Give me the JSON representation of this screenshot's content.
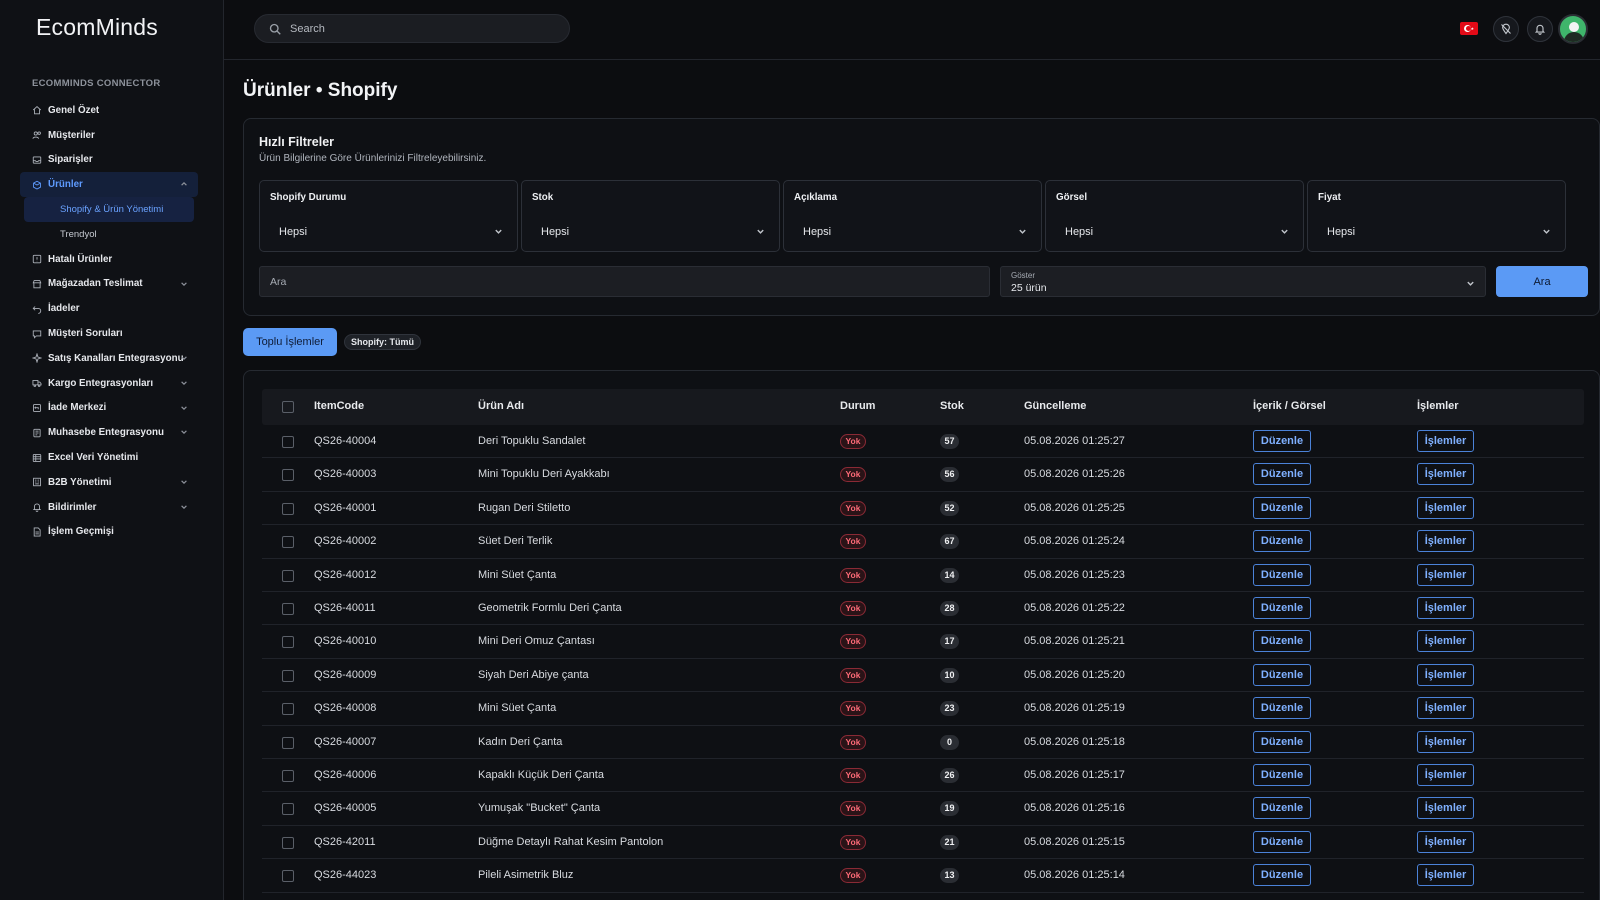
{
  "app": {
    "logo": "EcomMinds",
    "section_title": "ECOMMINDS CONNECTOR"
  },
  "sidebar": {
    "items": [
      {
        "label": "Genel Özet",
        "icon": "home-icon",
        "chevron": false
      },
      {
        "label": "Müşteriler",
        "icon": "users-icon",
        "chevron": false
      },
      {
        "label": "Siparişler",
        "icon": "inbox-icon",
        "chevron": false
      },
      {
        "label": "Ürünler",
        "icon": "box-icon",
        "chevron": true,
        "active": true
      },
      {
        "label": "Hatalı Ürünler",
        "icon": "alert-box-icon",
        "chevron": false
      },
      {
        "label": "Mağazadan Teslimat",
        "icon": "store-icon",
        "chevron": true
      },
      {
        "label": "İadeler",
        "icon": "return-icon",
        "chevron": false
      },
      {
        "label": "Müşteri Soruları",
        "icon": "chat-icon",
        "chevron": false
      },
      {
        "label": "Satış Kanalları Entegrasyonu",
        "icon": "sparkle-icon",
        "chevron": true
      },
      {
        "label": "Kargo Entegrasyonları",
        "icon": "truck-icon",
        "chevron": true
      },
      {
        "label": "İade Merkezi",
        "icon": "return-box-icon",
        "chevron": true
      },
      {
        "label": "Muhasebe Entegrasyonu",
        "icon": "ledger-icon",
        "chevron": true
      },
      {
        "label": "Excel Veri Yönetimi",
        "icon": "table-icon",
        "chevron": false
      },
      {
        "label": "B2B Yönetimi",
        "icon": "building-icon",
        "chevron": true
      },
      {
        "label": "Bildirimler",
        "icon": "bell-icon",
        "chevron": true
      },
      {
        "label": "İşlem Geçmişi",
        "icon": "document-icon",
        "chevron": false
      }
    ],
    "sub_items": [
      {
        "label": "Shopify & Ürün Yönetimi",
        "active": true
      },
      {
        "label": "Trendyol",
        "active": false
      }
    ]
  },
  "topbar": {
    "search_placeholder": "Search"
  },
  "page": {
    "title": "Ürünler • Shopify"
  },
  "filters": {
    "title": "Hızlı Filtreler",
    "subtitle": "Ürün Bilgilerine Göre Ürünlerinizi Filtreleyebilirsiniz.",
    "boxes": [
      {
        "label": "Shopify Durumu",
        "value": "Hepsi"
      },
      {
        "label": "Stok",
        "value": "Hepsi"
      },
      {
        "label": "Açıklama",
        "value": "Hepsi"
      },
      {
        "label": "Görsel",
        "value": "Hepsi"
      },
      {
        "label": "Fiyat",
        "value": "Hepsi"
      }
    ],
    "search_placeholder": "Ara",
    "show_label": "Göster",
    "show_value": "25 ürün",
    "search_button": "Ara"
  },
  "actions": {
    "bulk_button": "Toplu İşlemler",
    "chip": "Shopify: Tümü"
  },
  "table": {
    "headers": [
      "ItemCode",
      "Ürün Adı",
      "Durum",
      "Stok",
      "Güncelleme",
      "İçerik / Görsel",
      "İşlemler"
    ],
    "edit_label": "Düzenle",
    "actions_label": "İşlemler",
    "status_color": "#ff6b78",
    "rows": [
      {
        "code": "QS26-40004",
        "name": "Deri Topuklu Sandalet",
        "status": "Yok",
        "stock": "57",
        "updated": "05.08.2026 01:25:27"
      },
      {
        "code": "QS26-40003",
        "name": "Mini Topuklu Deri Ayakkabı",
        "status": "Yok",
        "stock": "56",
        "updated": "05.08.2026 01:25:26"
      },
      {
        "code": "QS26-40001",
        "name": "Rugan Deri Stiletto",
        "status": "Yok",
        "stock": "52",
        "updated": "05.08.2026 01:25:25"
      },
      {
        "code": "QS26-40002",
        "name": "Süet Deri Terlik",
        "status": "Yok",
        "stock": "67",
        "updated": "05.08.2026 01:25:24"
      },
      {
        "code": "QS26-40012",
        "name": "Mini Süet Çanta",
        "status": "Yok",
        "stock": "14",
        "updated": "05.08.2026 01:25:23"
      },
      {
        "code": "QS26-40011",
        "name": "Geometrik Formlu Deri Çanta",
        "status": "Yok",
        "stock": "28",
        "updated": "05.08.2026 01:25:22"
      },
      {
        "code": "QS26-40010",
        "name": "Mini Deri Omuz Çantası",
        "status": "Yok",
        "stock": "17",
        "updated": "05.08.2026 01:25:21"
      },
      {
        "code": "QS26-40009",
        "name": "Siyah Deri Abiye çanta",
        "status": "Yok",
        "stock": "10",
        "updated": "05.08.2026 01:25:20"
      },
      {
        "code": "QS26-40008",
        "name": "Mini Süet Çanta",
        "status": "Yok",
        "stock": "23",
        "updated": "05.08.2026 01:25:19"
      },
      {
        "code": "QS26-40007",
        "name": "Kadın Deri Çanta",
        "status": "Yok",
        "stock": "0",
        "updated": "05.08.2026 01:25:18"
      },
      {
        "code": "QS26-40006",
        "name": "Kapaklı Küçük Deri Çanta",
        "status": "Yok",
        "stock": "26",
        "updated": "05.08.2026 01:25:17"
      },
      {
        "code": "QS26-40005",
        "name": "Yumuşak \"Bucket\" Çanta",
        "status": "Yok",
        "stock": "19",
        "updated": "05.08.2026 01:25:16"
      },
      {
        "code": "QS26-42011",
        "name": "Düğme Detaylı Rahat Kesim Pantolon",
        "status": "Yok",
        "stock": "21",
        "updated": "05.08.2026 01:25:15"
      },
      {
        "code": "QS26-44023",
        "name": "Pileli Asimetrik Bluz",
        "status": "Yok",
        "stock": "13",
        "updated": "05.08.2026 01:25:14"
      }
    ]
  }
}
